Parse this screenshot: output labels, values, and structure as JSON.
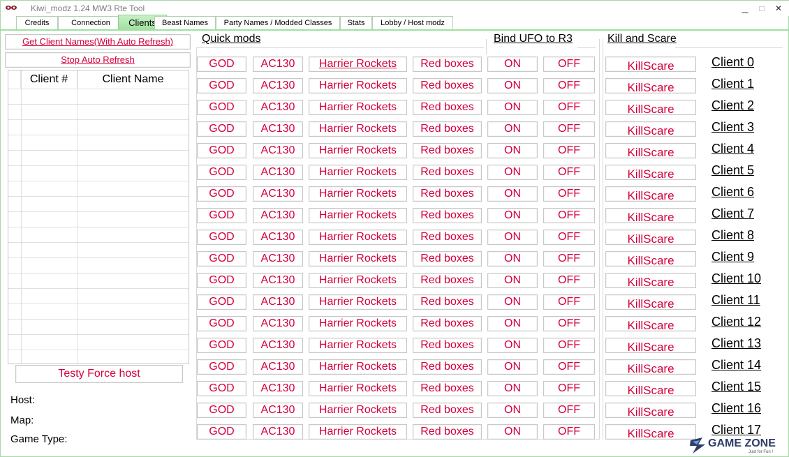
{
  "window": {
    "title": "Kiwi_modz 1.24 MW3 Rte Tool",
    "minimize": "▁",
    "maximize": "□",
    "close": "✕"
  },
  "tabs": [
    {
      "label": "Credits"
    },
    {
      "label": "Connection"
    },
    {
      "label": "Clients"
    },
    {
      "label": "Beast Names"
    },
    {
      "label": "Party Names / Modded Classes"
    },
    {
      "label": "Stats"
    },
    {
      "label": "Lobby / Host modz"
    }
  ],
  "left": {
    "get_names_label": "Get Client Names(With Auto Refresh)",
    "stop_refresh_label": "Stop Auto Refresh",
    "columns": [
      "Client #",
      "Client Name"
    ],
    "force_host_label": "Testy Force host",
    "host_label": "Host:",
    "map_label": "Map:",
    "gametype_label": "Game Type:"
  },
  "sections": {
    "quick_mods": "Quick mods",
    "bind_ufo": "Bind UFO to R3",
    "kill_scare": "Kill and Scare"
  },
  "buttons": {
    "god": "GOD",
    "ac130": "AC130",
    "harrier": "Harrier Rockets",
    "red_boxes": "Red boxes",
    "on": "ON",
    "off": "OFF",
    "kill": "KillScare"
  },
  "clients": [
    "Client 0",
    "Client 1",
    "Client 2",
    "Client 3",
    "Client 4",
    "Client 5",
    "Client 6",
    "Client 7",
    "Client 8",
    "Client 9",
    "Client 10",
    "Client 11",
    "Client 12",
    "Client 13",
    "Client 14",
    "Client 15",
    "Client 16",
    "Client 17"
  ],
  "watermark": {
    "text": "GAME ZONE",
    "sub": "Just for Fun !"
  },
  "colors": {
    "accent": "#d4003c",
    "tab_active": "#9fe09f"
  }
}
